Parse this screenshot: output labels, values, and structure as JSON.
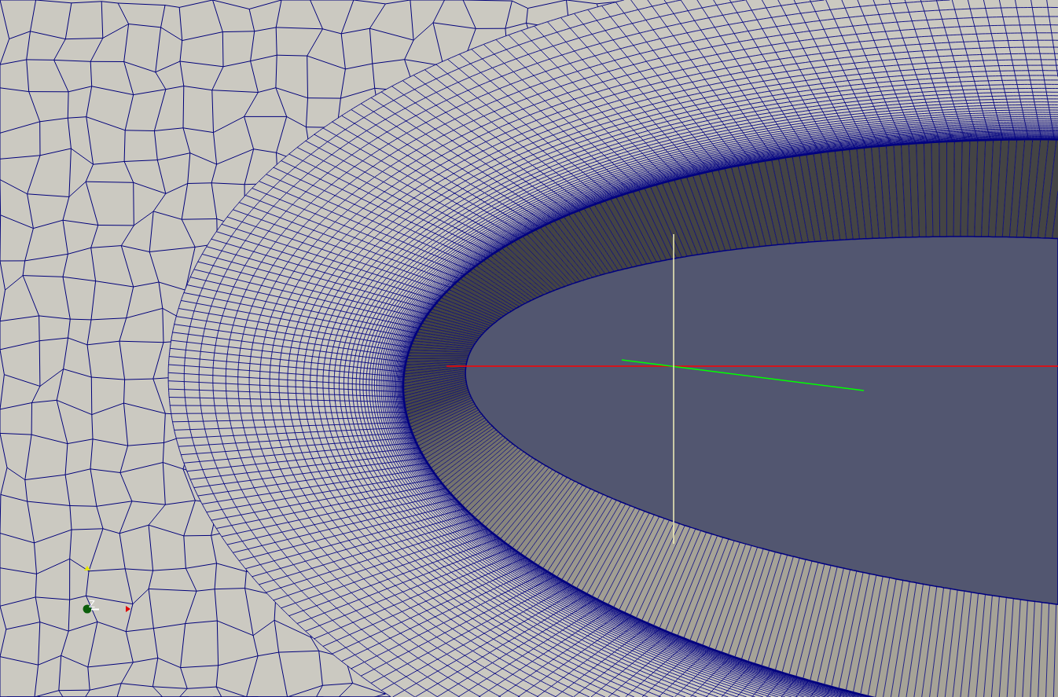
{
  "orientation_axes": {
    "label": "Z"
  }
}
